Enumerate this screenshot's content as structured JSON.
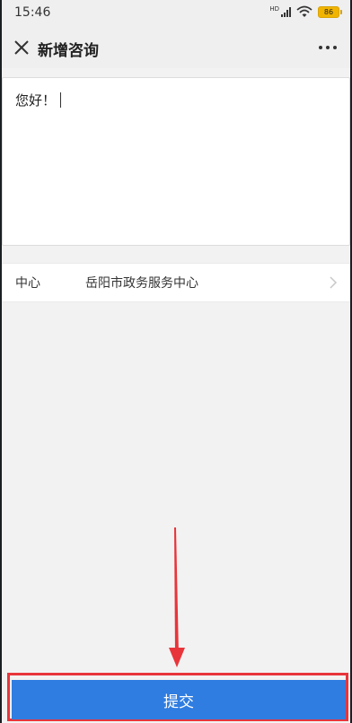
{
  "status_bar": {
    "time": "15:46",
    "network_label": "HD",
    "battery": "86",
    "battery_color": "#f1b400"
  },
  "nav": {
    "title": "新增咨询",
    "close_icon": "close-icon",
    "more_icon": "more-icon"
  },
  "message": {
    "text": "您好！"
  },
  "center": {
    "label": "中心",
    "value": "岳阳市政务服务中心"
  },
  "submit": {
    "label": "提交",
    "color": "#2f7de1"
  },
  "annotation": {
    "color": "#e8353b"
  }
}
